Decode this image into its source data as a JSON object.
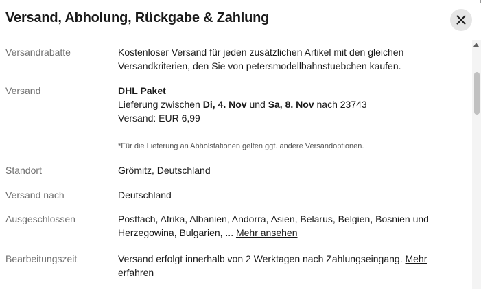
{
  "dialog": {
    "title": "Versand, Abholung, Rückgabe & Zahlung"
  },
  "icons": {
    "close": "close-icon",
    "scroll_up": "scroll-up-arrow-icon"
  },
  "rows": {
    "versandrabatte": {
      "label": "Versandrabatte",
      "text": "Kostenloser Versand für jeden zusätzlichen Artikel mit den gleichen Versandkriterien, den Sie von petersmodellbahnstuebchen kaufen."
    },
    "versand": {
      "label": "Versand",
      "service": "DHL Paket",
      "delivery_prefix": "Lieferung zwischen",
      "date_from": "Di, 4. Nov",
      "delivery_and": "und",
      "date_to": "Sa, 8. Nov",
      "delivery_suffix": "nach 23743",
      "cost": "Versand: EUR 6,99",
      "note": "*Für die Lieferung an Abholstationen gelten ggf. andere Versandoptionen."
    },
    "standort": {
      "label": "Standort",
      "value": "Grömitz, Deutschland"
    },
    "versand_nach": {
      "label": "Versand nach",
      "value": "Deutschland"
    },
    "ausgeschlossen": {
      "label": "Ausgeschlossen",
      "value": "Postfach, Afrika, Albanien, Andorra, Asien, Belarus, Belgien, Bosnien und Herzegowina, Bulgarien, ...",
      "link": "Mehr ansehen"
    },
    "bearbeitungszeit": {
      "label": "Bearbeitungszeit",
      "value": "Versand erfolgt innerhalb von 2 Werktagen nach Zahlungseingang.",
      "link": "Mehr erfahren"
    }
  },
  "colors": {
    "label_gray": "#707070",
    "text": "#191919",
    "close_bg": "#e5e5e5"
  }
}
